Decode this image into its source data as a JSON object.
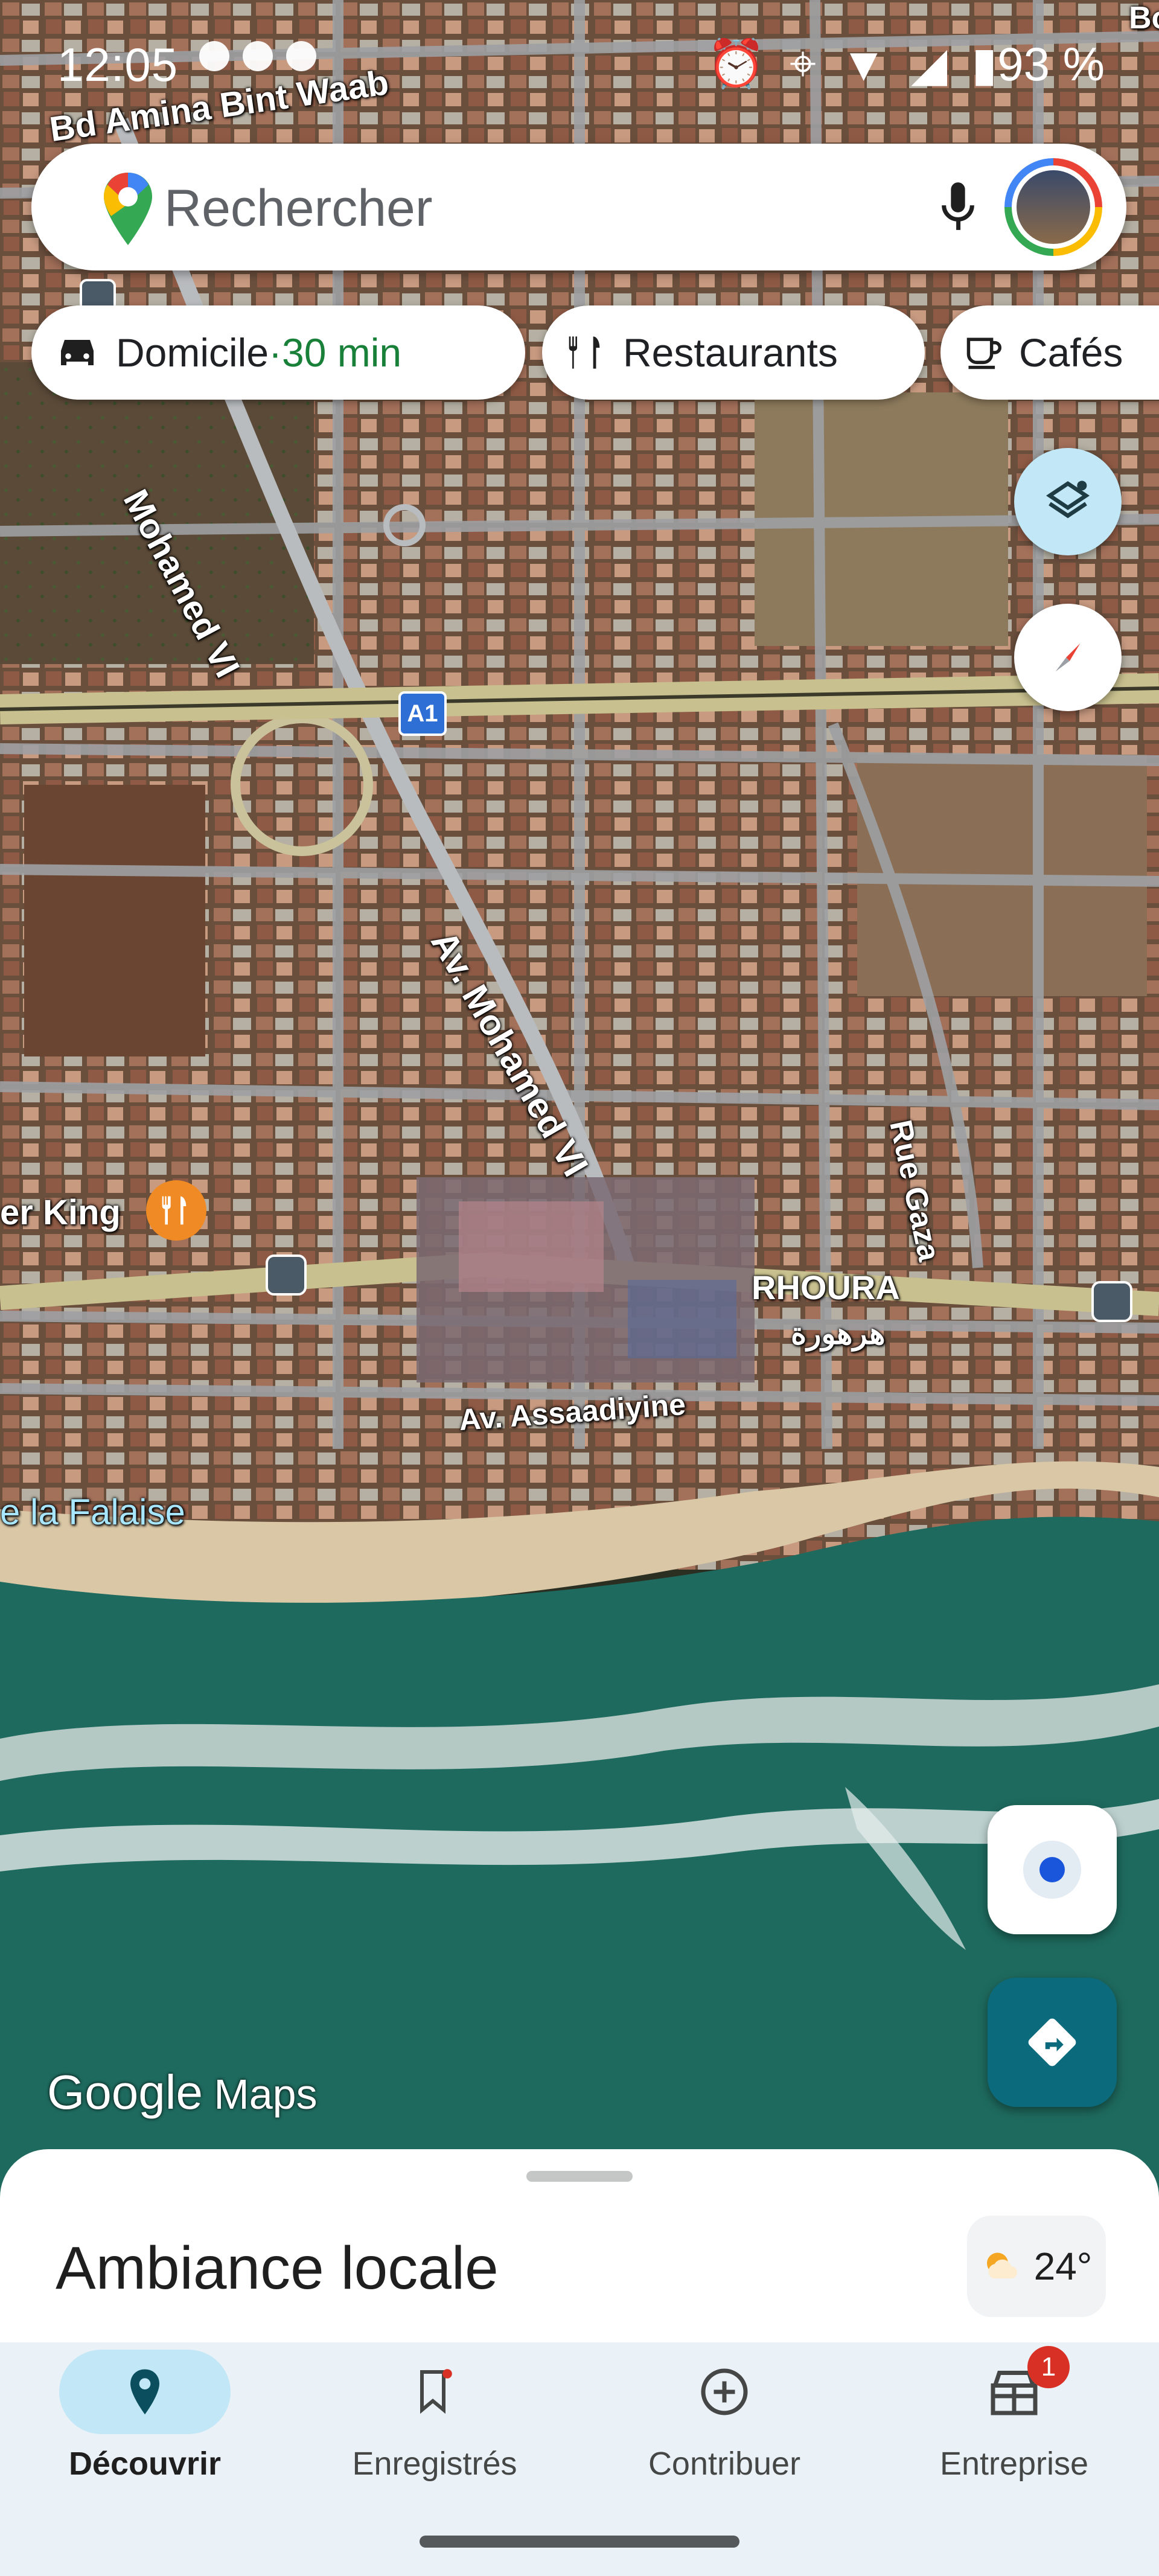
{
  "status_bar": {
    "time": "12:05",
    "battery": "93 %"
  },
  "search": {
    "placeholder": "Rechercher"
  },
  "chips": [
    {
      "label": "Domicile",
      "sep": " · ",
      "eta": "30 min"
    },
    {
      "label": "Restaurants"
    },
    {
      "label": "Cafés"
    }
  ],
  "map_labels": {
    "street1": "Bd Amina Bint Waab",
    "street2": "Mohamed VI",
    "highway": "A1",
    "avenue": "Av. Mohamed VI",
    "rue": "Rue Gaza",
    "place": "er King",
    "district": "RHOURA",
    "district_ar": "هرهورة",
    "assaadiyine": "Av. Assaadiyine",
    "falaise": "e la Falaise",
    "corner": "Bo"
  },
  "branding": {
    "google": "Google",
    "maps": "Maps"
  },
  "sheet": {
    "title": "Ambiance locale",
    "temperature": "24°"
  },
  "nav": [
    {
      "label": "Découvrir",
      "active": true
    },
    {
      "label": "Enregistrés"
    },
    {
      "label": "Contribuer"
    },
    {
      "label": "Entreprise",
      "badge": "1"
    }
  ],
  "colors": {
    "accent_green": "#188038",
    "fab_teal": "#0b6b7d",
    "location_blue": "#1a56db",
    "nav_bg": "#eaf1f7",
    "active_pill": "#c2e7f6"
  }
}
